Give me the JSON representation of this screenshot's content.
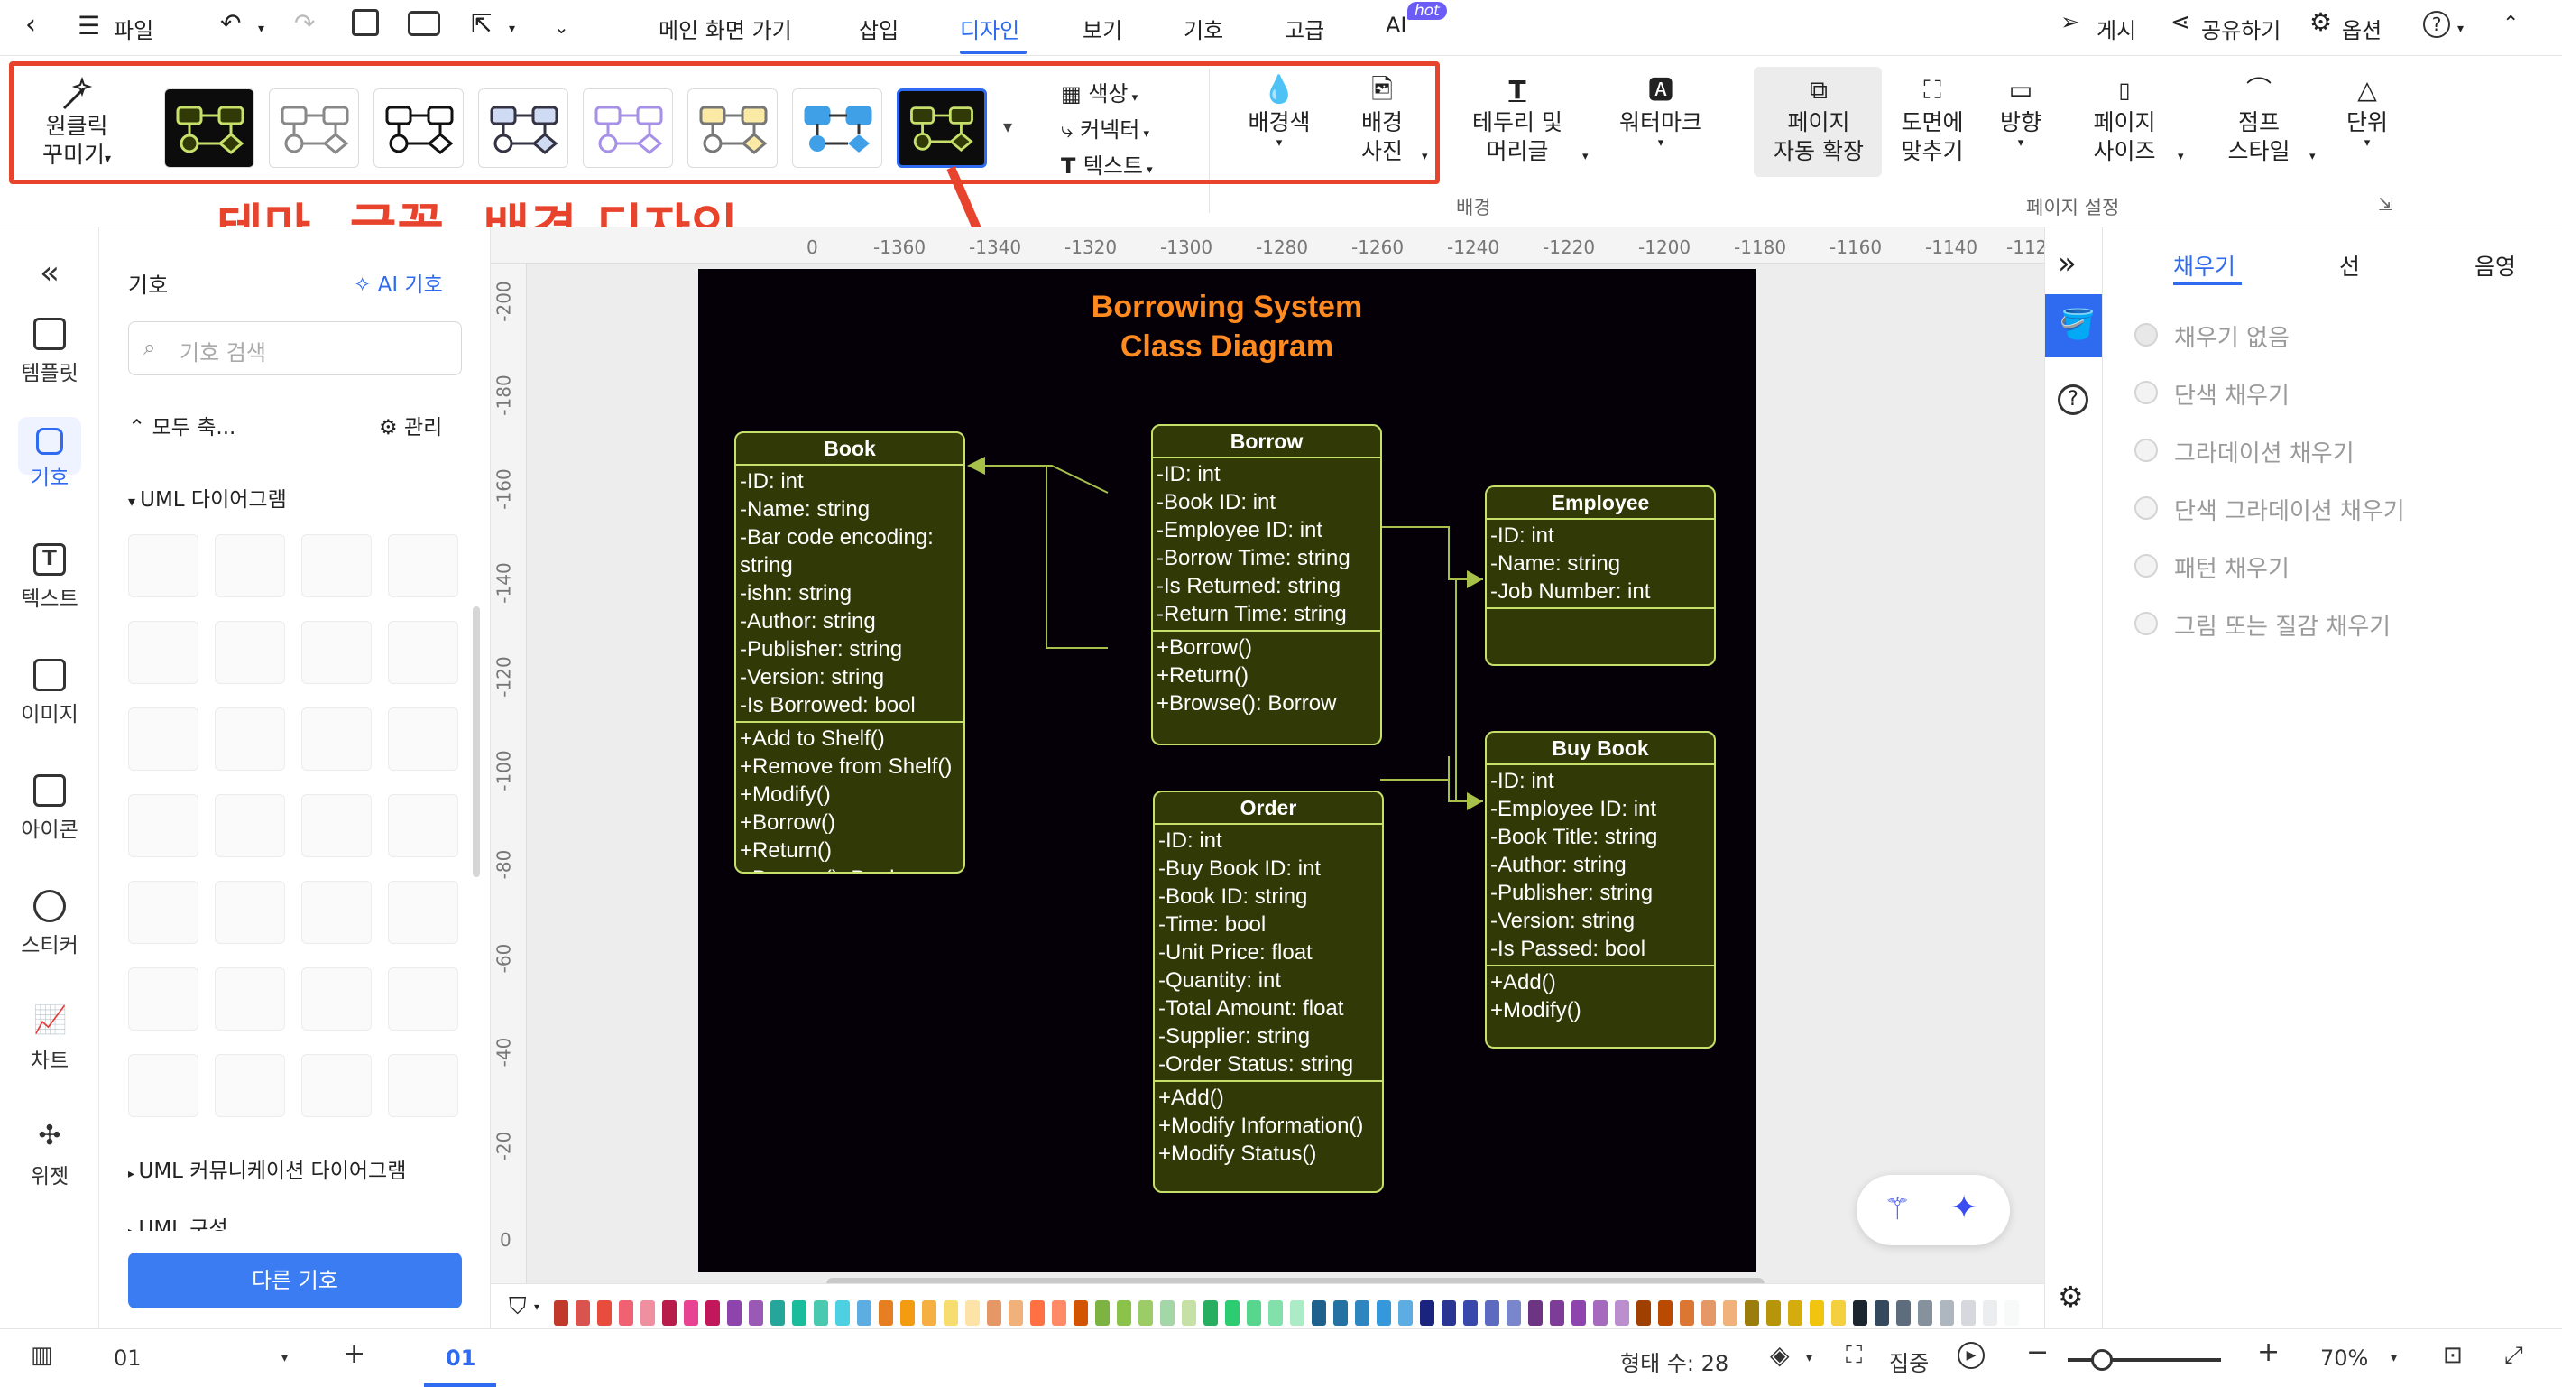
{
  "menubar": {
    "file": "파일",
    "tabs": [
      "메인 화면 가기",
      "삽입",
      "디자인",
      "보기",
      "기호",
      "고급",
      "AI"
    ],
    "hot_badge": "hot",
    "publish": "게시",
    "share": "공유하기",
    "options": "옵션"
  },
  "ribbon": {
    "oneclick": "원클릭",
    "beautify": "꾸미기",
    "color": "색상",
    "connector": "커넥터",
    "text": "텍스트",
    "bg_color": "배경색",
    "bg_photo_1": "배경",
    "bg_photo_2": "사진",
    "border_1": "테두리 및",
    "border_2": "머리글",
    "watermark": "워터마크",
    "auto_expand_1": "페이지",
    "auto_expand_2": "자동 확장",
    "fit_1": "도면에",
    "fit_2": "맞추기",
    "orientation": "방향",
    "page_size_1": "페이지",
    "page_size_2": "사이즈",
    "jump_1": "점프",
    "jump_2": "스타일",
    "unit": "단위",
    "section_background": "배경",
    "section_page_setup": "페이지 설정"
  },
  "annotation": "테마, 글꼴, 배경 디자인",
  "rail": [
    "템플릿",
    "기호",
    "텍스트",
    "이미지",
    "아이콘",
    "스티커",
    "차트",
    "위젯"
  ],
  "sympanel": {
    "title": "기호",
    "ai_symbols": "AI 기호",
    "search_placeholder": "기호 검색",
    "collapse_all": "모두 축...",
    "manage": "관리",
    "group_uml_class": "UML 다이어그램",
    "group_uml_comm": "UML 커뮤니케이션 다이어그램",
    "group_uml_struct": "UML 구성",
    "more_symbols": "다른 기호"
  },
  "ruler": {
    "h": [
      "-1360",
      "-1340",
      "-1320",
      "-1300",
      "-1280",
      "-1260",
      "-1240",
      "-1220",
      "-1200",
      "-1180",
      "-1160",
      "-1140",
      "-112"
    ],
    "h_first": "0",
    "v": [
      "-200",
      "-180",
      "-160",
      "-140",
      "-120",
      "-100",
      "-80",
      "-60",
      "-40",
      "-20",
      "0"
    ]
  },
  "diagram": {
    "title_1": "Borrowing System",
    "title_2": "Class Diagram",
    "book": {
      "name": "Book",
      "attrs": [
        "-ID: int",
        "-Name: string",
        "-Bar code encoding:",
        "string",
        "-ishn: string",
        "-Author: string",
        "-Publisher: string",
        "-Version: string",
        "-Is Borrowed: bool"
      ],
      "ops": [
        "+Add to Shelf()",
        "+Remove from Shelf()",
        "+Modify()",
        "+Borrow()",
        "+Return()",
        "+Browse(): Book"
      ]
    },
    "borrow": {
      "name": "Borrow",
      "attrs": [
        "-ID: int",
        "-Book ID: int",
        "-Employee ID: int",
        "-Borrow Time: string",
        "-Is Returned: string",
        "-Return Time: string"
      ],
      "ops": [
        "+Borrow()",
        "+Return()",
        "+Browse(): Borrow"
      ]
    },
    "employee": {
      "name": "Employee",
      "attrs": [
        "-ID: int",
        "-Name: string",
        "-Job Number: int"
      ],
      "ops": [
        ""
      ]
    },
    "buybook": {
      "name": "Buy Book",
      "attrs": [
        "-ID: int",
        "-Employee ID: int",
        "-Book Title: string",
        "-Author: string",
        "-Publisher: string",
        "-Version: string",
        "-Is Passed: bool"
      ],
      "ops": [
        "+Add()",
        "+Modify()"
      ]
    },
    "order": {
      "name": "Order",
      "attrs": [
        "-ID: int",
        "-Buy Book ID: int",
        "-Book ID: string",
        "-Time: bool",
        "-Unit Price: float",
        "-Quantity: int",
        "-Total Amount: float",
        "-Supplier: string",
        "-Order Status: string"
      ],
      "ops": [
        "+Add()",
        "+Modify Information()",
        "+Modify Status()"
      ]
    }
  },
  "rpanel": {
    "tabs": [
      "채우기",
      "선",
      "음영"
    ],
    "options": [
      "채우기 없음",
      "단색 채우기",
      "그라데이션 채우기",
      "단색 그라데이션 채우기",
      "패턴 채우기",
      "그림 또는 질감 채우기"
    ]
  },
  "status": {
    "page_select": "01",
    "page_tab": "01",
    "shape_count": "형태 수: 28",
    "focus": "집중",
    "zoom": "70%"
  },
  "colors": {
    "accent": "#2f6bf0",
    "annotation_red": "#e8432c",
    "diagram_title": "#ff8a1f",
    "node_fill": "#313a06",
    "node_border": "#c7e06a",
    "page_bg": "#050007"
  },
  "palette": [
    "#c0392b",
    "#d9534f",
    "#e74c3c",
    "#f06272",
    "#ef8fa0",
    "#b71c4a",
    "#e84393",
    "#c2185b",
    "#8e44ad",
    "#9b59b6",
    "#26a69a",
    "#1abc9c",
    "#48c9b0",
    "#4dd0e1",
    "#5dade2",
    "#e67e22",
    "#f39c12",
    "#f5b041",
    "#f7dc6f",
    "#fde3a7",
    "#e59866",
    "#f0b27a",
    "#ff7043",
    "#ff8a65",
    "#d35400",
    "#7cb342",
    "#8bc34a",
    "#9ccc65",
    "#a5d6a7",
    "#c5e1a5",
    "#27ae60",
    "#2ecc71",
    "#58d68d",
    "#82e0aa",
    "#abebc6",
    "#1f618d",
    "#2471a3",
    "#2e86c1",
    "#3498db",
    "#5dade2",
    "#1a237e",
    "#283593",
    "#3949ab",
    "#5c6bc0",
    "#7986cb",
    "#6c3483",
    "#7d3c98",
    "#8e44ad",
    "#a569bd",
    "#bb8fce",
    "#a04000",
    "#ba4a00",
    "#dc7633",
    "#e59866",
    "#f0b27a",
    "#9a7d0a",
    "#b7950b",
    "#d4ac0d",
    "#f1c40f",
    "#f4d03f",
    "#1b2631",
    "#34495e",
    "#5d6d7e",
    "#85929e",
    "#aeb6bf",
    "#d5d8dc",
    "#ebedef",
    "#f8f9f9"
  ]
}
